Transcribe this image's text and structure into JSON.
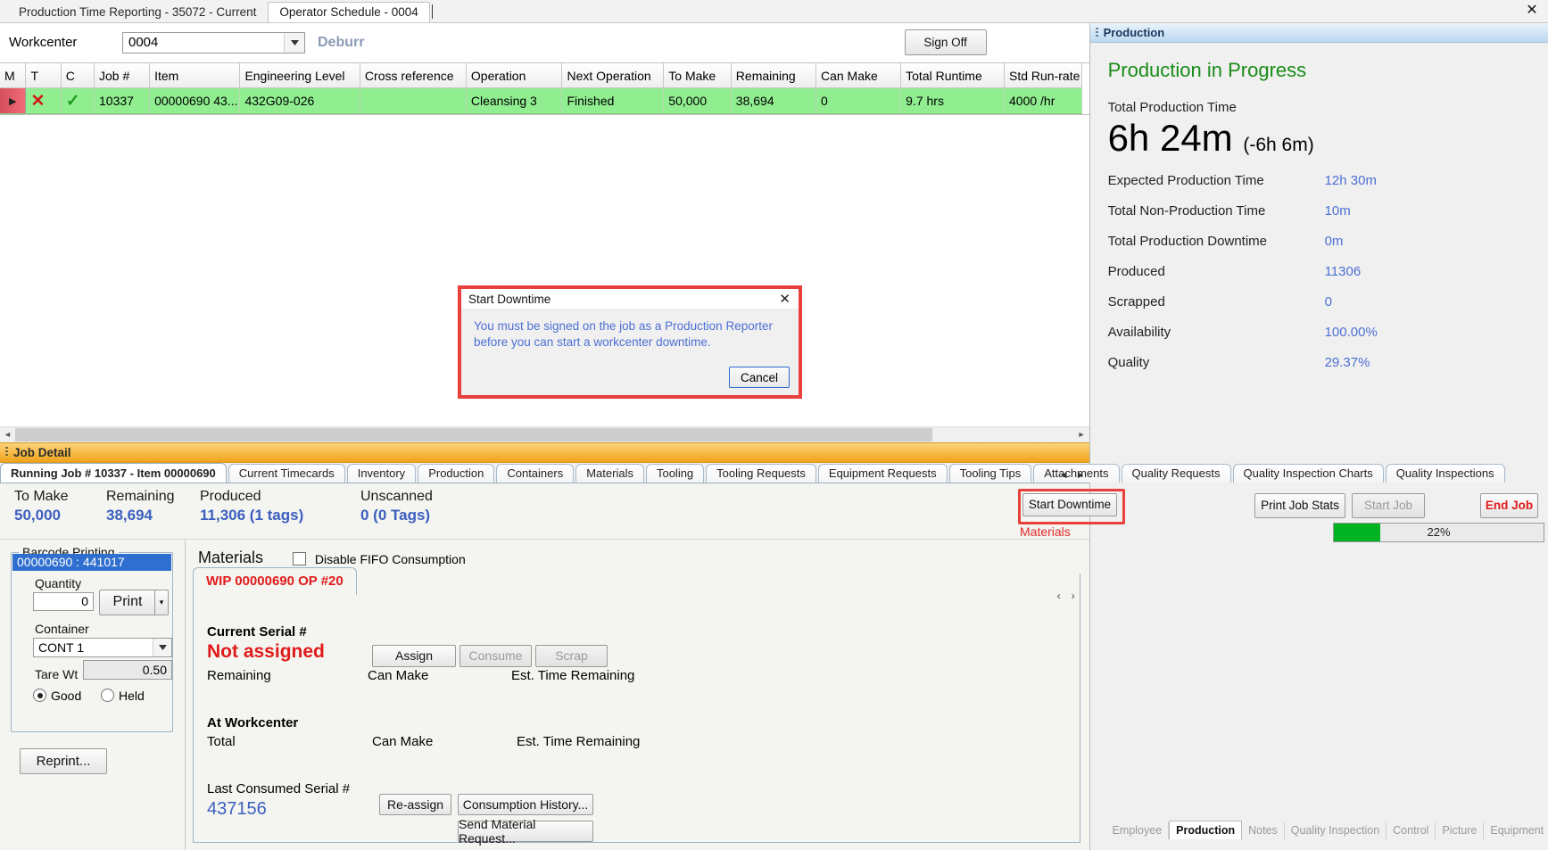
{
  "window": {
    "tabs": [
      {
        "label": "Production Time Reporting - 35072 - Current",
        "active": false
      },
      {
        "label": "Operator Schedule - 0004",
        "active": true
      }
    ],
    "close_icon": "✕"
  },
  "workcenter": {
    "label": "Workcenter",
    "value": "0004",
    "name": "Deburr",
    "sign_off_label": "Sign Off"
  },
  "grid": {
    "columns": [
      "M",
      "T",
      "C",
      "Job #",
      "Item",
      "Engineering Level",
      "Cross reference",
      "Operation",
      "Next Operation",
      "To Make",
      "Remaining",
      "Can Make",
      "Total Runtime",
      "Std Run-rate"
    ],
    "rows": [
      {
        "marker": "▶",
        "t": "✕",
        "c": "✓",
        "job": "10337",
        "item": "00000690  43...",
        "engineering_level": "432G09-026",
        "cross_reference": "",
        "operation": "Cleansing 3",
        "next_operation": "Finished",
        "to_make": "50,000",
        "remaining": "38,694",
        "can_make": "0",
        "total_runtime": "9.7 hrs",
        "std_run_rate": "4000 /hr"
      }
    ]
  },
  "job_detail": {
    "bar_title": "Job Detail",
    "tabs": [
      {
        "label": "Running Job # 10337 - Item 00000690",
        "active": true
      },
      {
        "label": "Current Timecards",
        "active": false
      },
      {
        "label": "Inventory",
        "active": false
      },
      {
        "label": "Production",
        "active": false
      },
      {
        "label": "Containers",
        "active": false
      },
      {
        "label": "Materials",
        "active": false
      },
      {
        "label": "Tooling",
        "active": false
      },
      {
        "label": "Tooling Requests",
        "active": false
      },
      {
        "label": "Equipment Requests",
        "active": false
      },
      {
        "label": "Tooling Tips",
        "active": false
      },
      {
        "label": "Attachments",
        "active": false
      },
      {
        "label": "Quality Requests",
        "active": false
      },
      {
        "label": "Quality Inspection Charts",
        "active": false
      },
      {
        "label": "Quality Inspections",
        "active": false
      }
    ],
    "nav_prev": "◄",
    "nav_next": "►"
  },
  "stats": {
    "to_make": {
      "label": "To Make",
      "value": "50,000"
    },
    "remaining": {
      "label": "Remaining",
      "value": "38,694"
    },
    "produced": {
      "label": "Produced",
      "value": "11,306 (1 tags)"
    },
    "unscanned": {
      "label": "Unscanned",
      "value": "0 (0 Tags)"
    },
    "start_downtime_label": "Start Downtime",
    "materials_warning": "Materials not assigned",
    "print_job_stats_label": "Print Job Stats",
    "start_job_label": "Start Job",
    "end_job_label": "End Job",
    "progress_percent": "22%",
    "progress_value": 22
  },
  "barcode_printing": {
    "group_title": "Barcode Printing",
    "serial_header": "00000690 : 441017",
    "quantity_label": "Quantity",
    "quantity_value": "0",
    "print_label": "Print",
    "print_dropdown_icon": "▾",
    "container_label": "Container",
    "container_value": "CONT 1",
    "tare_wt_label": "Tare Wt",
    "tare_wt_value": "0.50",
    "good_label": "Good",
    "held_label": "Held",
    "reprint_label": "Reprint..."
  },
  "materials": {
    "title": "Materials",
    "disable_fifo_label": "Disable FIFO Consumption",
    "wip_tab_label": "WIP 00000690 OP #20",
    "current_serial_label": "Current Serial #",
    "current_serial_value": "Not assigned",
    "remaining_label": "Remaining",
    "can_make_label": "Can Make",
    "est_time_remaining_label": "Est. Time Remaining",
    "assign_label": "Assign",
    "consume_label": "Consume",
    "scrap_label": "Scrap",
    "at_workcenter_label": "At Workcenter",
    "total_label": "Total",
    "can_make_label2": "Can Make",
    "est_time_remaining_label2": "Est. Time Remaining",
    "last_consumed_label": "Last Consumed Serial #",
    "last_consumed_value": "437156",
    "reassign_label": "Re-assign",
    "consumption_history_label": "Consumption History...",
    "send_material_request_label": "Send Material Request...",
    "nav_prev": "‹",
    "nav_next": "›"
  },
  "production_panel": {
    "header": "Production",
    "heading": "Production in Progress",
    "total_production_time_label": "Total Production Time",
    "total_production_time_value": "6h 24m",
    "total_production_time_delta": "(-6h 6m)",
    "metrics": [
      {
        "label": "Expected Production Time",
        "value": "12h 30m"
      },
      {
        "label": "Total Non-Production Time",
        "value": "10m"
      },
      {
        "label": "Total Production Downtime",
        "value": "0m"
      },
      {
        "label": "Produced",
        "value": "11306"
      },
      {
        "label": "Scrapped",
        "value": "0"
      },
      {
        "label": "Availability",
        "value": "100.00%"
      },
      {
        "label": "Quality",
        "value": "29.37%"
      }
    ],
    "tabs": [
      {
        "label": "Employee",
        "active": false
      },
      {
        "label": "Production",
        "active": true
      },
      {
        "label": "Notes",
        "active": false
      },
      {
        "label": "Quality Inspection",
        "active": false
      },
      {
        "label": "Control",
        "active": false
      },
      {
        "label": "Picture",
        "active": false
      },
      {
        "label": "Equipment",
        "active": false
      }
    ]
  },
  "dialog": {
    "title": "Start Downtime",
    "close_icon": "✕",
    "message": "You must be signed on the job as a Production Reporter before you can start a workcenter downtime.",
    "cancel_label": "Cancel"
  },
  "colors": {
    "accent_red": "#e8403c",
    "row_green": "#90ee90",
    "link_blue": "#3b5fbf",
    "progress_green": "#00b322"
  }
}
